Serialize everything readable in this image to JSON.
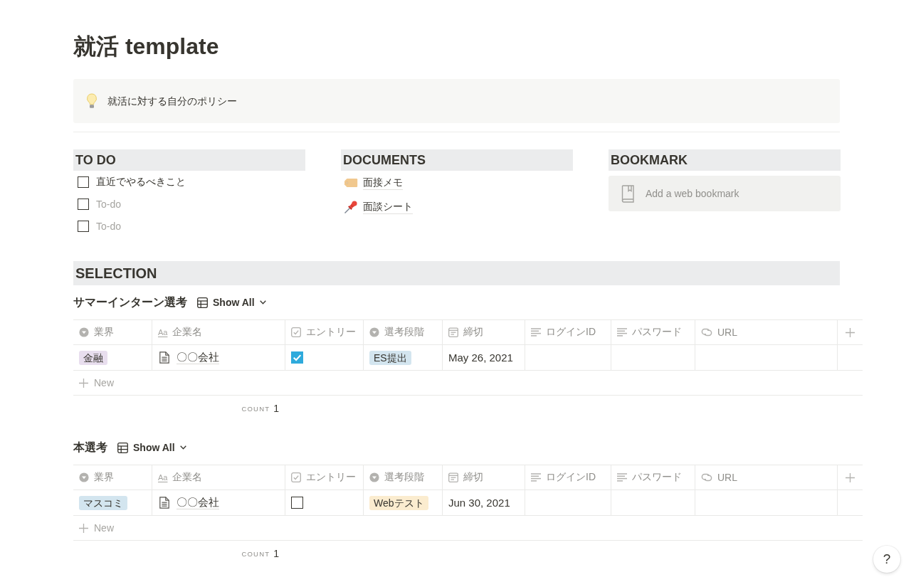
{
  "page": {
    "title": "就活 template"
  },
  "callout": {
    "text": "就活に対する自分のポリシー"
  },
  "columns": [
    {
      "kind": "todo",
      "heading": "TO DO",
      "items": [
        {
          "text": "直近でやるべきこと",
          "checked": false
        },
        {
          "placeholder": "To-do",
          "checked": false
        },
        {
          "placeholder": "To-do",
          "checked": false
        }
      ]
    },
    {
      "kind": "links",
      "heading": "DOCUMENTS",
      "items": [
        {
          "text": "面接メモ"
        },
        {
          "text": "面談シート"
        }
      ]
    },
    {
      "kind": "bookmark",
      "heading": "BOOKMARK",
      "placeholder": "Add a web bookmark"
    }
  ],
  "section": {
    "heading": "SELECTION"
  },
  "databases": [
    {
      "title": "サマーインターン選考",
      "view": "Show All",
      "columns": [
        {
          "kind": "select",
          "label": "業界"
        },
        {
          "kind": "title",
          "glyph": "Aa",
          "label": "企業名"
        },
        {
          "kind": "checkbox",
          "label": "エントリー"
        },
        {
          "kind": "select",
          "label": "選考段階"
        },
        {
          "kind": "date",
          "label": "締切"
        },
        {
          "kind": "text",
          "label": "ログインID"
        },
        {
          "kind": "text",
          "label": "パスワード"
        },
        {
          "kind": "url",
          "label": "URL"
        }
      ],
      "rows": [
        {
          "cells": [
            {
              "text": "金融",
              "color": "#e8deee"
            },
            {
              "text": "〇〇会社"
            },
            {
              "checked": true
            },
            {
              "text": "ES提出",
              "color": "#d3e5ef"
            },
            {
              "text": "May 26, 2021"
            }
          ]
        }
      ],
      "new_label": "New",
      "count_label": "COUNT",
      "count": "1"
    },
    {
      "title": "本選考",
      "view": "Show All",
      "columns": [
        {
          "kind": "select",
          "label": "業界"
        },
        {
          "kind": "title",
          "glyph": "Aa",
          "label": "企業名"
        },
        {
          "kind": "checkbox",
          "label": "エントリー"
        },
        {
          "kind": "select",
          "label": "選考段階"
        },
        {
          "kind": "date",
          "label": "締切"
        },
        {
          "kind": "text",
          "label": "ログインID"
        },
        {
          "kind": "text",
          "label": "パスワード"
        },
        {
          "kind": "url",
          "label": "URL"
        }
      ],
      "rows": [
        {
          "cells": [
            {
              "text": "マスコミ",
              "color": "#d3e5ef"
            },
            {
              "text": "〇〇会社"
            },
            {
              "checked": false
            },
            {
              "text": "Webテスト",
              "color": "#fbeccf"
            },
            {
              "text": "Jun 30, 2021"
            }
          ]
        }
      ],
      "new_label": "New",
      "count_label": "COUNT",
      "count": "1"
    }
  ],
  "help_button": {
    "label": "?"
  }
}
